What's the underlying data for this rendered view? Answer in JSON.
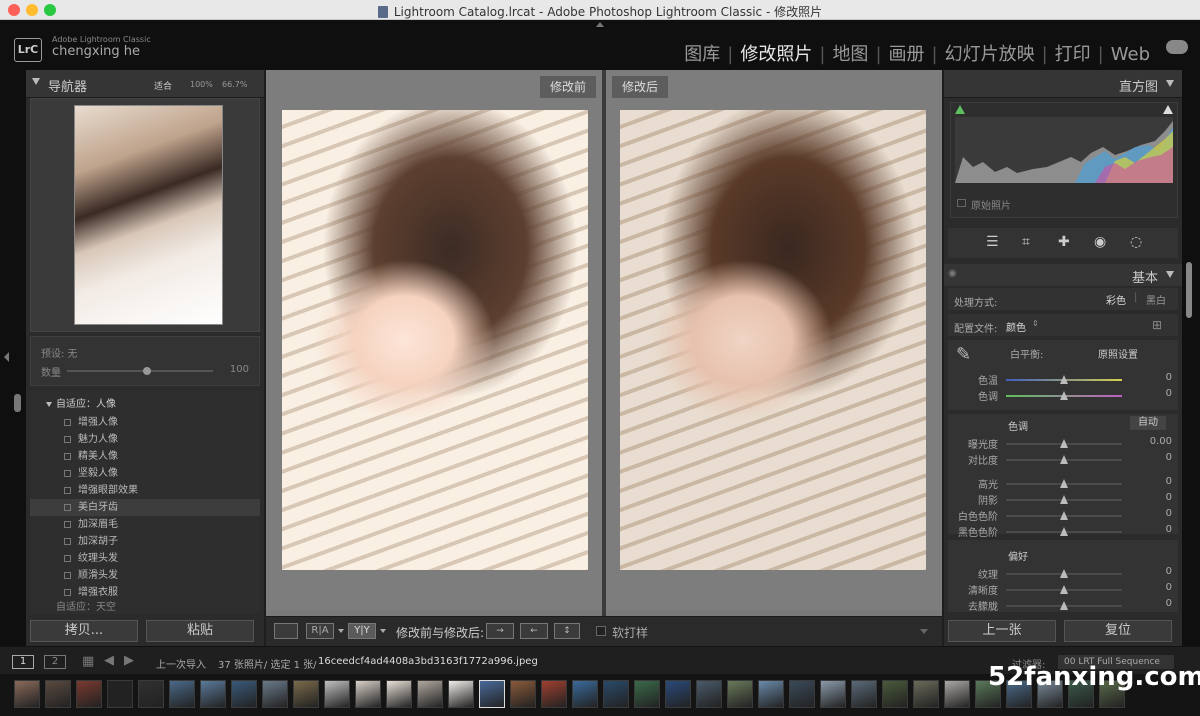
{
  "window": {
    "title": "Lightroom Catalog.lrcat - Adobe Photoshop Lightroom Classic - 修改照片"
  },
  "identity": {
    "badge": "LrC",
    "product": "Adobe Lightroom Classic",
    "user": "chengxing he"
  },
  "modules": [
    {
      "label": "图库",
      "active": false
    },
    {
      "label": "修改照片",
      "active": true
    },
    {
      "label": "地图",
      "active": false
    },
    {
      "label": "画册",
      "active": false
    },
    {
      "label": "幻灯片放映",
      "active": false
    },
    {
      "label": "打印",
      "active": false
    },
    {
      "label": "Web",
      "active": false
    }
  ],
  "navigator": {
    "title": "导航器",
    "fit": "适合",
    "z100": "100%",
    "z667": "66.7%"
  },
  "preset": {
    "label": "预设: 无",
    "amount_label": "数量",
    "amount_value": "100",
    "amount_level": 0.55
  },
  "presets": {
    "group": "自适应：人像",
    "items": [
      "增强人像",
      "魅力人像",
      "精美人像",
      "坚毅人像",
      "增强眼部效果",
      "美白牙齿",
      "加深眉毛",
      "加深胡子",
      "纹理头发",
      "顺滑头发",
      "增强衣服"
    ],
    "selected_index": 5,
    "next_group": "自适应：天空"
  },
  "left_buttons": {
    "copy": "拷贝...",
    "paste": "粘贴"
  },
  "compare": {
    "before": "修改前",
    "after": "修改后"
  },
  "toolbar": {
    "ra": "R|A",
    "yy": "Y|Y",
    "before_after_label": "修改前与修改后:",
    "soft_proof": "软打样"
  },
  "histogram": {
    "title": "直方图",
    "original": "原始照片"
  },
  "basic": {
    "title": "基本",
    "treatment_label": "处理方式:",
    "color": "彩色",
    "bw": "黑白",
    "profile_label": "配置文件:",
    "profile_value": "颜色",
    "wb_label": "白平衡:",
    "wb_value": "原照设置",
    "temp": {
      "label": "色温",
      "value": "0",
      "level": 0.5
    },
    "tint": {
      "label": "色调",
      "value": "0",
      "level": 0.5
    },
    "tone_label": "色调",
    "auto": "自动",
    "exposure": {
      "label": "曝光度",
      "value": "0.00",
      "level": 0.5
    },
    "contrast": {
      "label": "对比度",
      "value": "0",
      "level": 0.5
    },
    "highlights": {
      "label": "高光",
      "value": "0",
      "level": 0.5
    },
    "shadows": {
      "label": "阴影",
      "value": "0",
      "level": 0.5
    },
    "whites": {
      "label": "白色色阶",
      "value": "0",
      "level": 0.5
    },
    "blacks": {
      "label": "黑色色阶",
      "value": "0",
      "level": 0.5
    },
    "presence_label": "偏好",
    "texture": {
      "label": "纹理",
      "value": "0",
      "level": 0.5
    },
    "clarity": {
      "label": "清晰度",
      "value": "0",
      "level": 0.5
    },
    "dehaze": {
      "label": "去朦胧",
      "value": "0",
      "level": 0.5
    }
  },
  "right_buttons": {
    "prev": "上一张",
    "reset": "复位"
  },
  "filmbar": {
    "view1": "1",
    "view2": "2",
    "source": "上一次导入",
    "count": "37 张照片/ 选定 1 张/",
    "filename": "16ceedcf4ad4408a3bd3163f1772a996.jpeg",
    "filter_label": "过滤器:",
    "filter_value": "00 LRT Full Sequence"
  },
  "watermark": "52fanxing.com"
}
